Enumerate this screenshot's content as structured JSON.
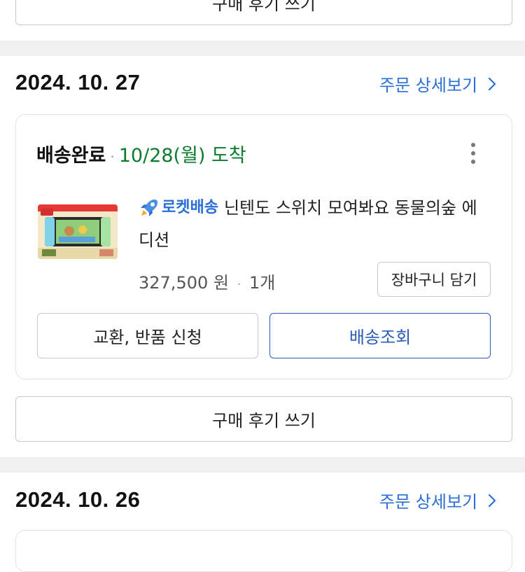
{
  "top_review_button": {
    "label": "구매 후기 쓰기"
  },
  "orders": [
    {
      "date": "2024. 10. 27",
      "detail_link": "주문 상세보기",
      "status": "배송완료",
      "arrival": "10/28(월) 도착",
      "badge_label": "로켓배송",
      "product_name": "닌텐도 스위치 모여봐요 동물의숲 에디션",
      "product_name_line1": "닌텐도 스위치 모여봐요 동물의숲 에",
      "product_name_line2": "디션",
      "price": "327,500 원",
      "quantity": "1개",
      "cart_button": "장바구니 담기",
      "exchange_button": "교환, 반품 신청",
      "tracking_button": "배송조회",
      "review_button": "구매 후기 쓰기"
    },
    {
      "date": "2024. 10. 26",
      "detail_link": "주문 상세보기"
    }
  ],
  "icons": {
    "chevron": "chevron-right-icon",
    "kebab": "more-vertical-icon",
    "rocket": "rocket-icon"
  },
  "colors": {
    "link_blue": "#2a6fd6",
    "arrival_green": "#0a7d2c",
    "tracking_border": "#2a5bb8",
    "separator_gray": "#f0f0f0"
  }
}
